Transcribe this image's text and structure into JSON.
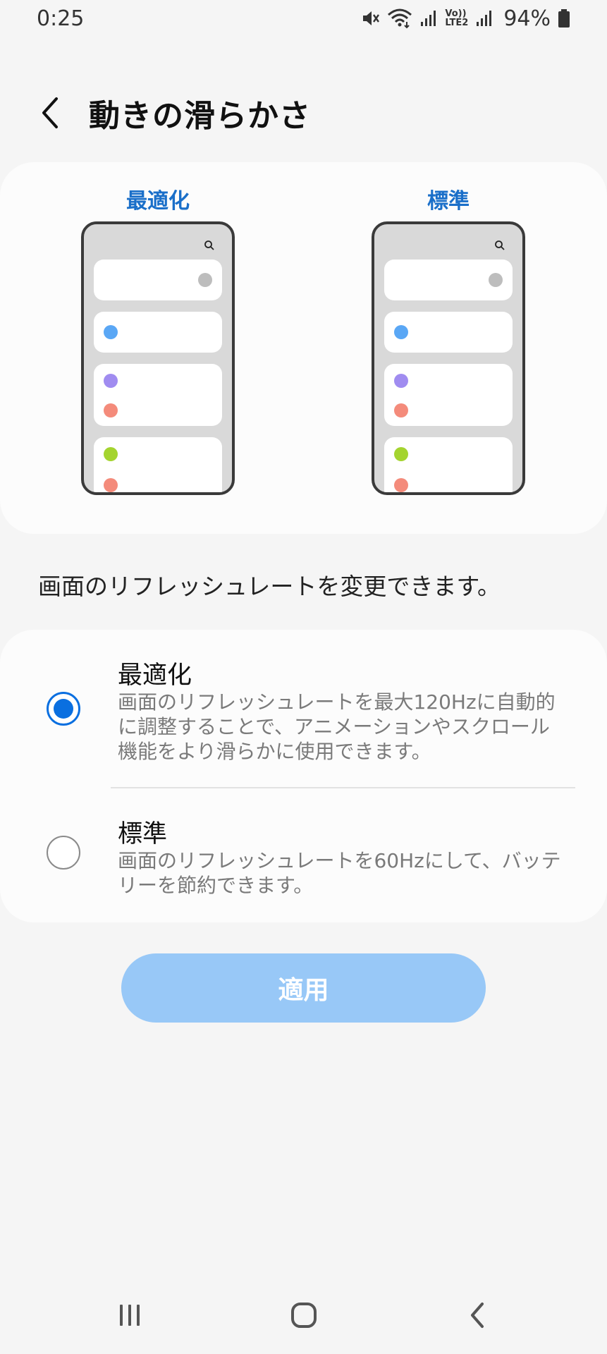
{
  "status_bar": {
    "time": "0:25",
    "lte_label_top": "Vo))",
    "lte_label_bottom": "LTE2",
    "battery": "94%",
    "icons": [
      "mute-icon",
      "wifi-icon",
      "signal-icon",
      "volte-icon",
      "signal-icon",
      "battery-icon"
    ]
  },
  "header": {
    "title": "動きの滑らかさ",
    "back_icon": "chevron-left-icon"
  },
  "preview": {
    "left_label": "最適化",
    "right_label": "標準",
    "dot_colors": [
      "#5aa7f5",
      "#a08cf0",
      "#f48b7b",
      "#a4d42f",
      "#f48b7b"
    ],
    "toggle_color": "#bdbdbd",
    "label_color": "#1a6fc9"
  },
  "description": "画面のリフレッシュレートを変更できます。",
  "options": [
    {
      "title": "最適化",
      "description": "画面のリフレッシュレートを最大120Hzに自動的に調整することで、アニメーションやスクロール機能をより滑らかに使用できます。",
      "selected": true
    },
    {
      "title": "標準",
      "description": "画面のリフレッシュレートを60Hzにして、バッテリーを節約できます。",
      "selected": false
    }
  ],
  "apply_button": {
    "label": "適用",
    "color": "#98c8f7"
  },
  "nav_bar": {
    "recent_icon": "recent-apps-icon",
    "home_icon": "home-icon",
    "back_icon": "back-icon"
  },
  "colors": {
    "accent": "#0a6fe0",
    "background": "#f5f5f5",
    "card": "#fcfcfc"
  }
}
